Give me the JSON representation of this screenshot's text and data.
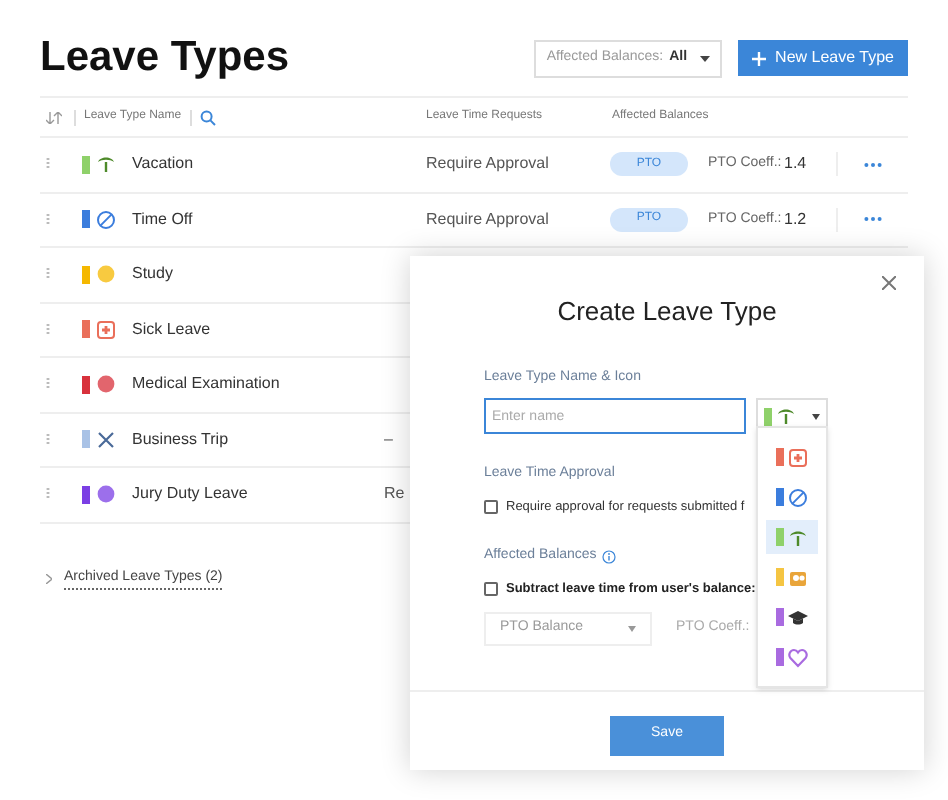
{
  "title": "Leave Types",
  "filter": {
    "label": "Affected Balances:",
    "value": "All"
  },
  "new_button": "New Leave Type",
  "columns": [
    "Leave Type Name",
    "Leave Time Requests",
    "Affected Balances"
  ],
  "rows": [
    {
      "name": "Vacation",
      "color": "#8fd16a",
      "kind": "palm",
      "requests": "Require Approval",
      "balance": "PTO",
      "coeff_label": "PTO Coeff.:",
      "coeff": "1.4"
    },
    {
      "name": "Time Off",
      "color": "#3b7ddd",
      "kind": "ban",
      "requests": "Require Approval",
      "balance": "PTO",
      "coeff_label": "PTO Coeff.:",
      "coeff": "1.2"
    },
    {
      "name": "Study",
      "color": "#f5b800",
      "kind": "dot"
    },
    {
      "name": "Sick Leave",
      "color": "#ea6f5a",
      "kind": "medical"
    },
    {
      "name": "Medical Examination",
      "color": "#d8323c",
      "kind": "dot"
    },
    {
      "name": "Business Trip",
      "color": "#a9c2e6",
      "kind": "cross",
      "requests": "–"
    },
    {
      "name": "Jury Duty Leave",
      "color": "#7b3fe4",
      "kind": "dot",
      "requests": "Re"
    }
  ],
  "archived": "Archived Leave Types (2)",
  "dialog": {
    "title": "Create Leave Type",
    "name_label": "Leave Type Name & Icon",
    "name_placeholder": "Enter name",
    "picked": {
      "color": "#8fd16a",
      "kind": "palm"
    },
    "options": [
      {
        "color": "#ea6f5a",
        "kind": "medical",
        "selected": false
      },
      {
        "color": "#3b7ddd",
        "kind": "ban",
        "selected": false
      },
      {
        "color": "#8fd16a",
        "kind": "palm",
        "selected": true
      },
      {
        "color": "#f5c542",
        "kind": "people",
        "selected": false
      },
      {
        "color": "#a96be0",
        "kind": "cap",
        "selected": false
      },
      {
        "color": "#a96be0",
        "kind": "heart",
        "selected": false
      }
    ],
    "approval_label": "Leave Time Approval",
    "approval_checkbox": {
      "label": "Require approval for requests submitted f",
      "checked": false
    },
    "balances_label": "Affected Balances",
    "subtract_checkbox": {
      "label": "Subtract leave time from user's balance:",
      "checked": false
    },
    "balance_select": "PTO Balance",
    "coeff_label": "PTO Coeff.:",
    "save": "Save"
  }
}
